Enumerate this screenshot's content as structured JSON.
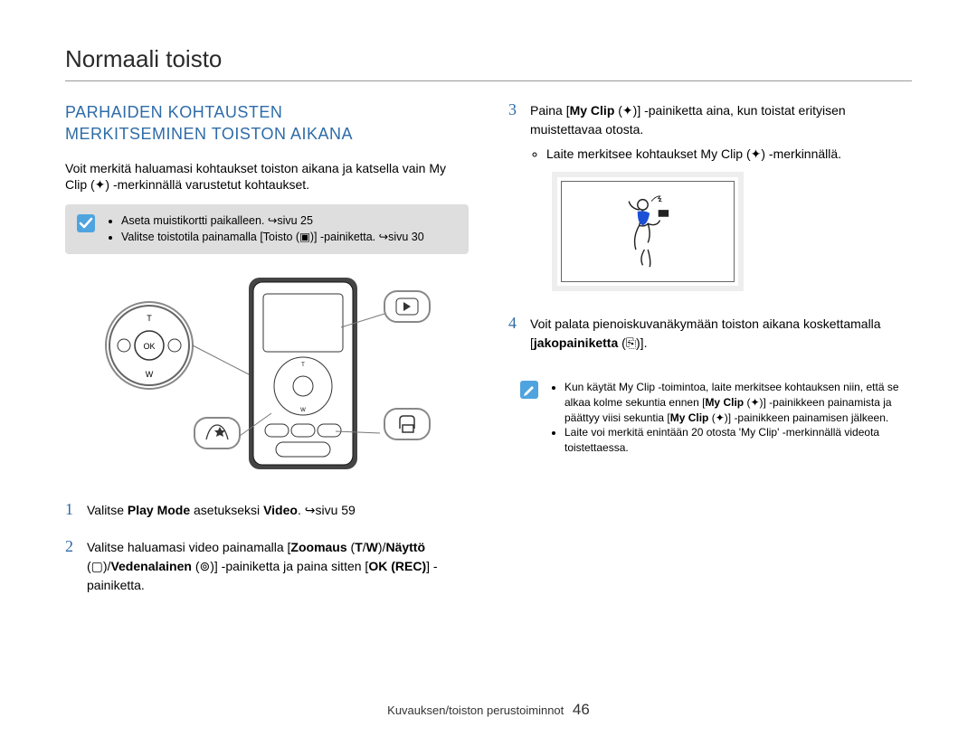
{
  "page_title": "Normaali toisto",
  "left": {
    "heading_l1": "PARHAIDEN KOHTAUSTEN",
    "heading_l2": "MERKITSEMINEN TOISTON AIKANA",
    "intro": "Voit merkitä haluamasi kohtaukset toiston aikana ja katsella vain My Clip (✦) -merkinnällä varustetut kohtaukset.",
    "callout_1_items": [
      "Aseta muistikortti paikalleen. ↪sivu 25",
      "Valitse toistotila painamalla [Toisto (▣)] -painiketta. ↪sivu 30"
    ],
    "steps": {
      "1": "Valitse Play Mode asetukseksi Video. ↪sivu 59",
      "2": "Valitse haluamasi video painamalla [Zoomaus (T/W)/Näyttö (▢)/Vedenalainen (⊚)] -painiketta ja paina sitten [OK (REC)] -painiketta."
    }
  },
  "right": {
    "steps": {
      "3": {
        "text": "Paina [My Clip (✦)] -painiketta aina, kun toistat erityisen muistettavaa otosta.",
        "bullets": [
          "Laite merkitsee kohtaukset My Clip (✦) -merkinnällä."
        ]
      },
      "4": "Voit palata pienoiskuvanäkymään toiston aikana koskettamalla [jakopainiketta (⎘)]."
    },
    "callout_2_items": [
      "Kun käytät My Clip -toimintoa, laite merkitsee kohtauksen niin, että se alkaa kolme sekuntia ennen [My Clip (✦)] -painikkeen painamista ja päättyy viisi sekuntia [My Clip (✦)] -painikkeen painamisen jälkeen.",
      "Laite voi merkitä enintään 20 otosta 'My Clip' -merkinnällä videota toistettaessa."
    ]
  },
  "footer_section": "Kuvauksen/toiston perustoiminnot",
  "footer_page": "46"
}
